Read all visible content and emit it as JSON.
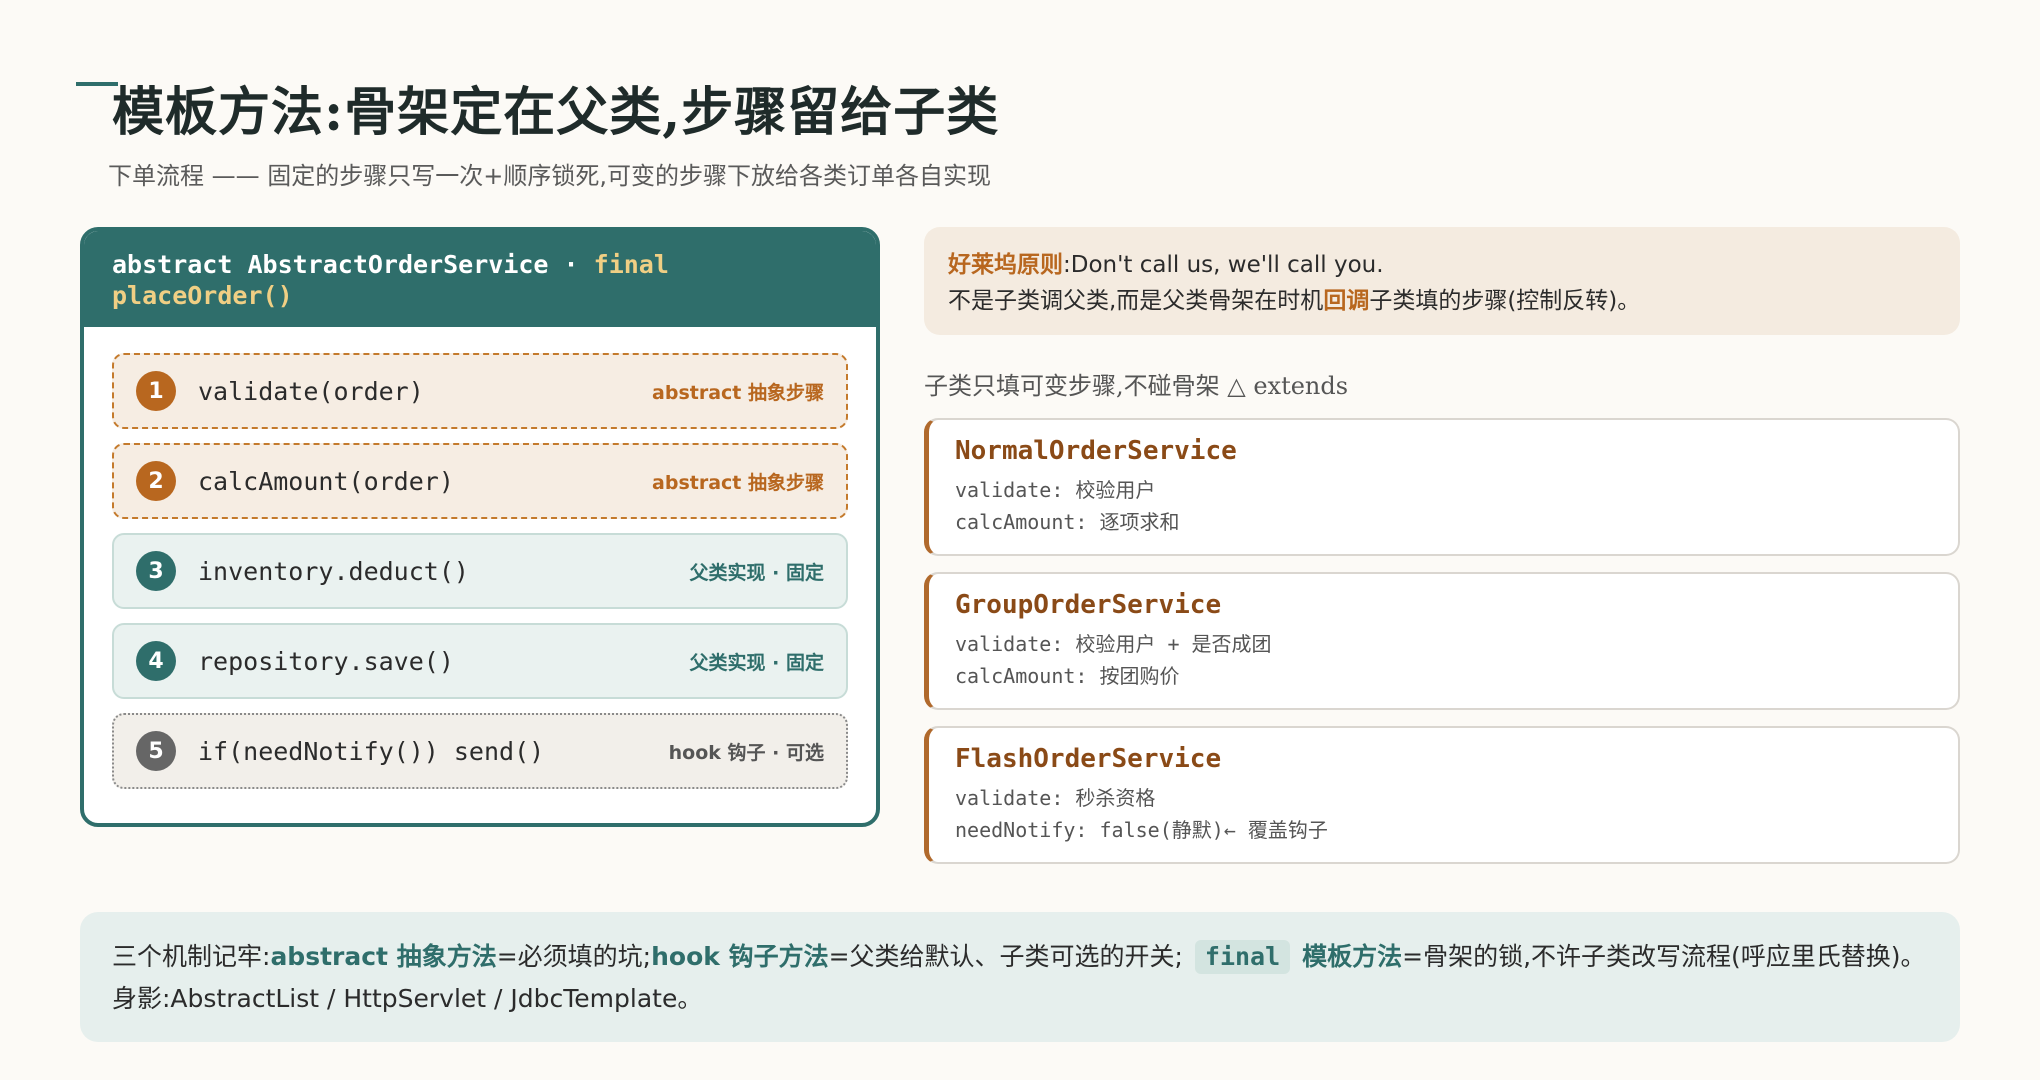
{
  "title": "模板方法:骨架定在父类,步骤留给子类",
  "subtitle": "下单流程 —— 固定的步骤只写一次+顺序锁死,可变的步骤下放给各类订单各自实现",
  "template_card": {
    "header_prefix": "abstract AbstractOrderService · ",
    "header_keyword": "final",
    "header_method": "placeOrder()",
    "steps": [
      {
        "num": "1",
        "code": "validate(order)",
        "tag": "abstract 抽象步骤"
      },
      {
        "num": "2",
        "code": "calcAmount(order)",
        "tag": "abstract 抽象步骤"
      },
      {
        "num": "3",
        "code": "inventory.deduct()",
        "tag": "父类实现 · 固定"
      },
      {
        "num": "4",
        "code": "repository.save()",
        "tag": "父类实现 · 固定"
      },
      {
        "num": "5",
        "code": "if(needNotify()) send()",
        "tag": "hook 钩子 · 可选"
      }
    ]
  },
  "hollywood": {
    "label": "好莱坞原则",
    "line1_rest": ":Don't call us, we'll call you.",
    "line2_a": "不是子类调父类,而是父类骨架在时机",
    "line2_hl": "回调",
    "line2_b": "子类填的步骤(控制反转)。"
  },
  "subclasses_label": "子类只填可变步骤,不碰骨架 △ extends",
  "subclasses": [
    {
      "name": "NormalOrderService",
      "line1": "validate: 校验用户",
      "line2": "calcAmount: 逐项求和"
    },
    {
      "name": "GroupOrderService",
      "line1": "validate: 校验用户 + 是否成团",
      "line2": "calcAmount: 按团购价"
    },
    {
      "name": "FlashOrderService",
      "line1": "validate: 秒杀资格",
      "line2": "needNotify: false(静默)← 覆盖钩子"
    }
  ],
  "footer": {
    "p1": "三个机制记牢:",
    "t1": "abstract 抽象方法",
    "p2": "=必须填的坑;",
    "t2": "hook 钩子方法",
    "p3": "=父类给默认、子类可选的开关; ",
    "pill": "final",
    "t3": "模板方法",
    "p4": "=骨架的锁,不许子类改写流程(呼应里氏替换)。 身影:AbstractList / HttpServlet / JdbcTemplate。"
  }
}
